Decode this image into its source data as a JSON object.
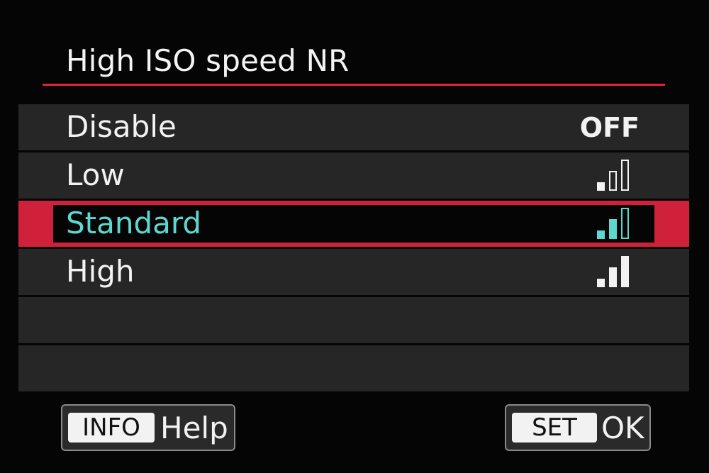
{
  "menu_title": "High ISO speed NR",
  "accent_color": "#d0213a",
  "highlight_text_color": "#5fd7cf",
  "options": [
    {
      "label": "Disable",
      "value_text": "OFF",
      "level": 0,
      "selected": false
    },
    {
      "label": "Low",
      "level": 1,
      "selected": false
    },
    {
      "label": "Standard",
      "level": 2,
      "selected": true
    },
    {
      "label": "High",
      "level": 3,
      "selected": false
    }
  ],
  "empty_row_count": 2,
  "buttons": {
    "info": {
      "tag": "INFO",
      "label": "Help"
    },
    "set": {
      "tag": "SET",
      "label": "OK"
    }
  }
}
